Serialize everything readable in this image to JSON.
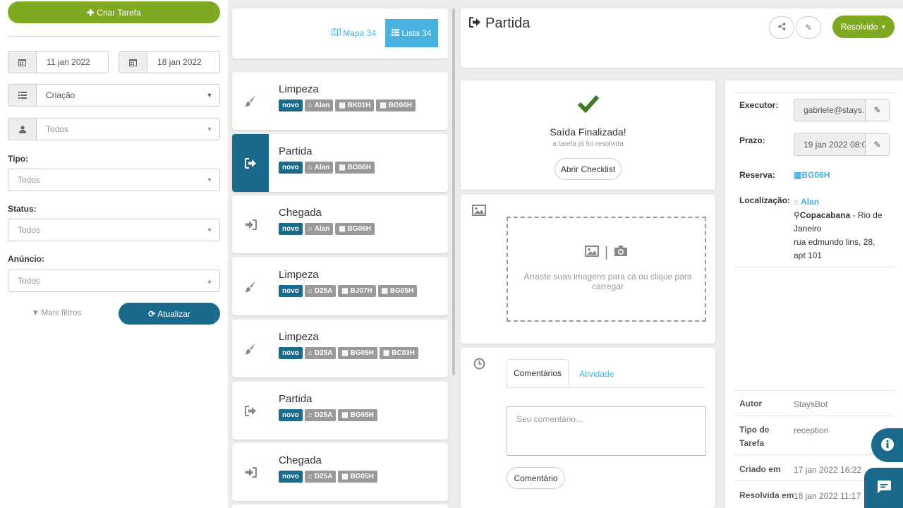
{
  "sidebar": {
    "create_label": "Criar Tarefa",
    "date_from": "11 jan 2022",
    "date_to": "18 jan 2022",
    "order_select": "Criação",
    "person_select": "Todos",
    "type_label": "Tipo:",
    "type_select": "Todos",
    "status_label": "Status:",
    "status_select": "Todos",
    "listing_label": "Anúncio:",
    "listing_select": "Todos",
    "more_filters": "Mais filtros",
    "update_label": "Atualizar"
  },
  "view_toggle": {
    "map_label": "Mapa 34",
    "list_label": "Lista 34"
  },
  "tasks": [
    {
      "title": "Limpeza",
      "icon": "brush-icon",
      "tags": [
        "novo",
        "Alan",
        "BK01H",
        "BG06H"
      ]
    },
    {
      "title": "Partida",
      "icon": "sign-out-icon",
      "tags": [
        "novo",
        "Alan",
        "BG06H"
      ]
    },
    {
      "title": "Chegada",
      "icon": "sign-in-icon",
      "tags": [
        "novo",
        "Alan",
        "BG06H"
      ]
    },
    {
      "title": "Limpeza",
      "icon": "brush-icon",
      "tags": [
        "novo",
        "D25A",
        "BJ07H",
        "BG05H"
      ]
    },
    {
      "title": "Limpeza",
      "icon": "brush-icon",
      "tags": [
        "novo",
        "D25A",
        "BG05H",
        "BC03H"
      ]
    },
    {
      "title": "Partida",
      "icon": "sign-out-icon",
      "tags": [
        "novo",
        "D25A",
        "BG05H"
      ]
    },
    {
      "title": "Chegada",
      "icon": "sign-in-icon",
      "tags": [
        "novo",
        "D25A",
        "BG05H"
      ]
    }
  ],
  "detail": {
    "title": "Partida",
    "resolved_label": "Resolvido",
    "check_title": "Saída Finalizada!",
    "check_sub": "a tarefa já foi resolvida",
    "checklist_btn": "Abrir Checklist",
    "dropzone_text": "Arraste suas imagens para cá ou clique para carregar",
    "tab_comments": "Comentários",
    "tab_activity": "Atividade",
    "comment_placeholder": "Seu comentário...",
    "comment_btn": "Comentário"
  },
  "info": {
    "executor_label": "Executor:",
    "executor_value": "gabriele@stays.",
    "deadline_label": "Prazo:",
    "deadline_value": "19 jan 2022 08:0",
    "reservation_label": "Reserva:",
    "reservation_value": "BG06H",
    "location_label": "Localização:",
    "location_owner": "Alan",
    "location_city_bold": "Copacabana",
    "location_city_rest": " - Rio de Janeiro",
    "location_address": "rua edmundo lins, 28, apt 101",
    "author_label": "Autor",
    "author_value": "StaysBot",
    "type_label_1": "Tipo de",
    "type_label_2": "Tarefa",
    "type_value": "reception",
    "created_label": "Criado em",
    "created_value": "17 jan 2022 16:22",
    "resolved_label": "Resolvida em",
    "resolved_value": "18 jan 2022 11:17"
  },
  "colors": {
    "green": "#7fa823",
    "blue": "#1a6a8c",
    "light_blue": "#4ab0dd"
  }
}
